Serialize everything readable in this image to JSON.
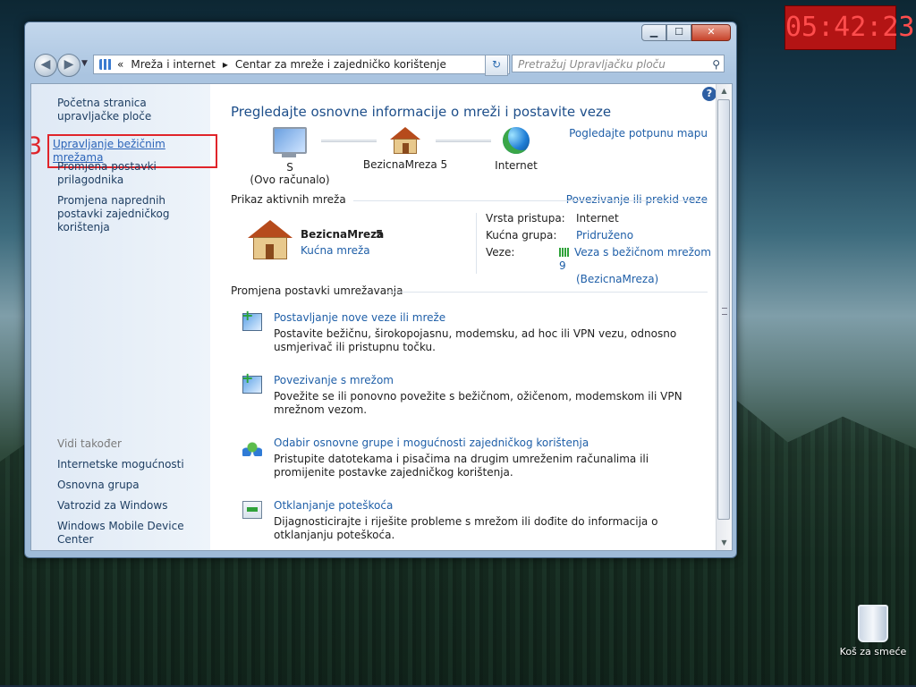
{
  "desktop": {
    "clock": "05:42:23",
    "recycle_bin_label": "Koš za smeće"
  },
  "window": {
    "caption": {
      "minimize": "▁",
      "maximize": "☐",
      "close": "✕"
    },
    "address": {
      "prefix": "«",
      "segments": [
        "Mreža i internet",
        "Centar za mreže i zajedničko korištenje"
      ],
      "separator": "▸"
    },
    "search": {
      "placeholder": "Pretražuj Upravljačku ploču"
    },
    "left_pane": {
      "links": [
        "Početna stranica upravljačke ploče",
        "Upravljanje bežičnim mrežama",
        "Promjena postavki prilagodnika",
        "Promjena naprednih postavki zajedničkog korištenja"
      ],
      "step_marker": "3",
      "see_also_heading": "Vidi također",
      "see_also": [
        "Internetske mogućnosti",
        "Osnovna grupa",
        "Vatrozid za Windows",
        "Windows Mobile Device Center"
      ]
    },
    "main": {
      "help": "?",
      "title": "Pregledajte osnovne informacije o mreži i postavite veze",
      "view_map": "Pogledajte potpunu mapu",
      "map": {
        "computer_name": "S",
        "computer_sub": "(Ovo računalo)",
        "network_name": "BezicnaMreza  5",
        "internet": "Internet"
      },
      "active_networks": {
        "heading": "Prikaz aktivnih mreža",
        "connect_link": "Povezivanje ili prekid veze",
        "name": "BezicnaMreza",
        "number": "5",
        "type": "Kućna mreža",
        "access_type_label": "Vrsta pristupa:",
        "access_type_value": "Internet",
        "homegroup_label": "Kućna grupa:",
        "homegroup_value": "Pridruženo",
        "connections_label": "Veze:",
        "connection_line1": "Veza s bežičnom mrežom 9",
        "connection_line2": "(BezicnaMreza)"
      },
      "change_settings": {
        "heading": "Promjena postavki umrežavanja",
        "tasks": [
          {
            "title": "Postavljanje nove veze ili mreže",
            "desc": "Postavite bežičnu, širokopojasnu, modemsku, ad hoc ili VPN vezu, odnosno usmjerivač ili pristupnu točku."
          },
          {
            "title": "Povezivanje s mrežom",
            "desc": "Povežite se ili ponovno povežite s bežičnom, ožičenom, modemskom ili VPN mrežnom vezom."
          },
          {
            "title": "Odabir osnovne grupe i mogućnosti zajedničkog korištenja",
            "desc": "Pristupite datotekama i pisačima na drugim umreženim računalima ili promijenite postavke zajedničkog korištenja."
          },
          {
            "title": "Otklanjanje poteškoća",
            "desc": "Dijagnosticirajte i riješite probleme s mrežom ili dođite do informacija o otklanjanju poteškoća."
          }
        ]
      }
    }
  }
}
